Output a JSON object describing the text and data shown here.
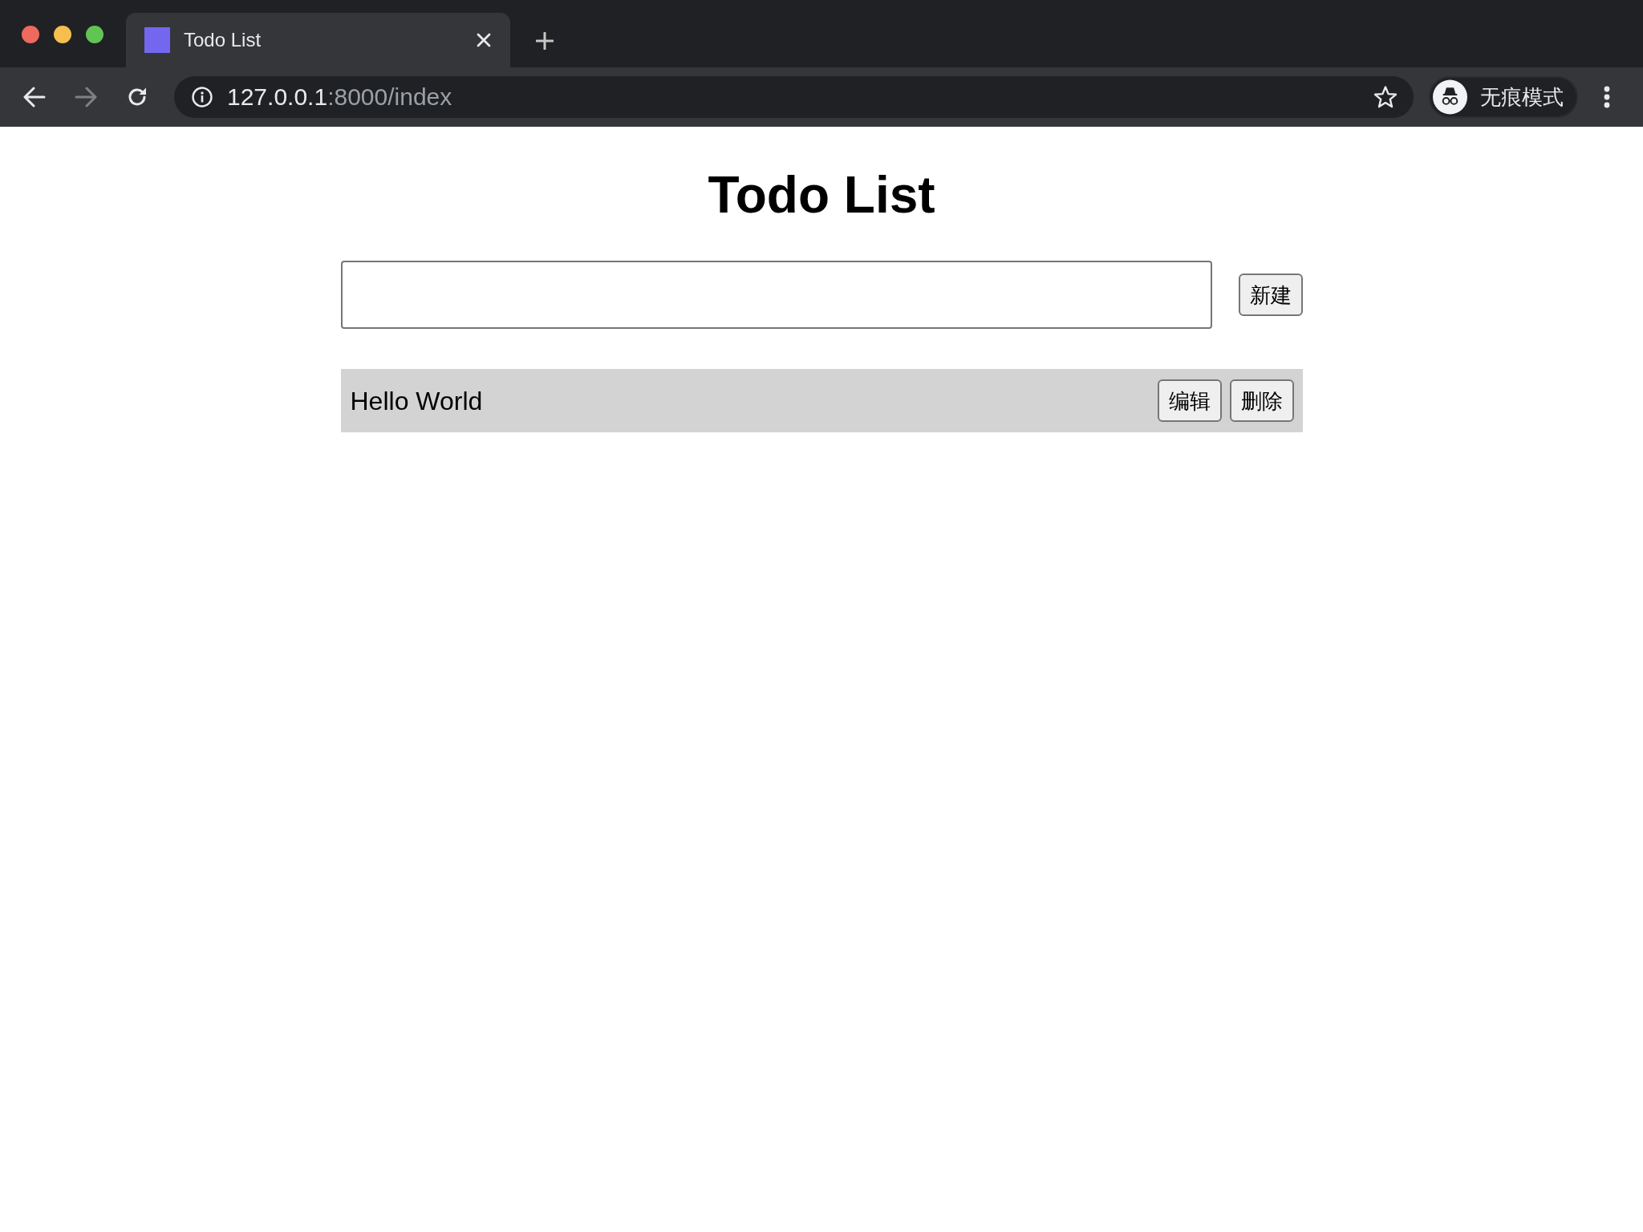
{
  "browser": {
    "tabs": [
      {
        "title": "Todo List",
        "selected": true
      }
    ],
    "navigation": [
      {
        "kind": "back",
        "disabled": false
      },
      {
        "kind": "forward",
        "disabled": true
      },
      {
        "kind": "reload",
        "disabled": false
      }
    ],
    "address": {
      "host": "127.0.0.1",
      "path": ":8000/index"
    },
    "profile": {
      "label": "无痕模式"
    }
  },
  "page": {
    "title": "Todo List",
    "add_button": "新建",
    "todos": [
      {
        "text": "Hello World",
        "actions": [
          "编辑",
          "删除"
        ]
      }
    ]
  }
}
